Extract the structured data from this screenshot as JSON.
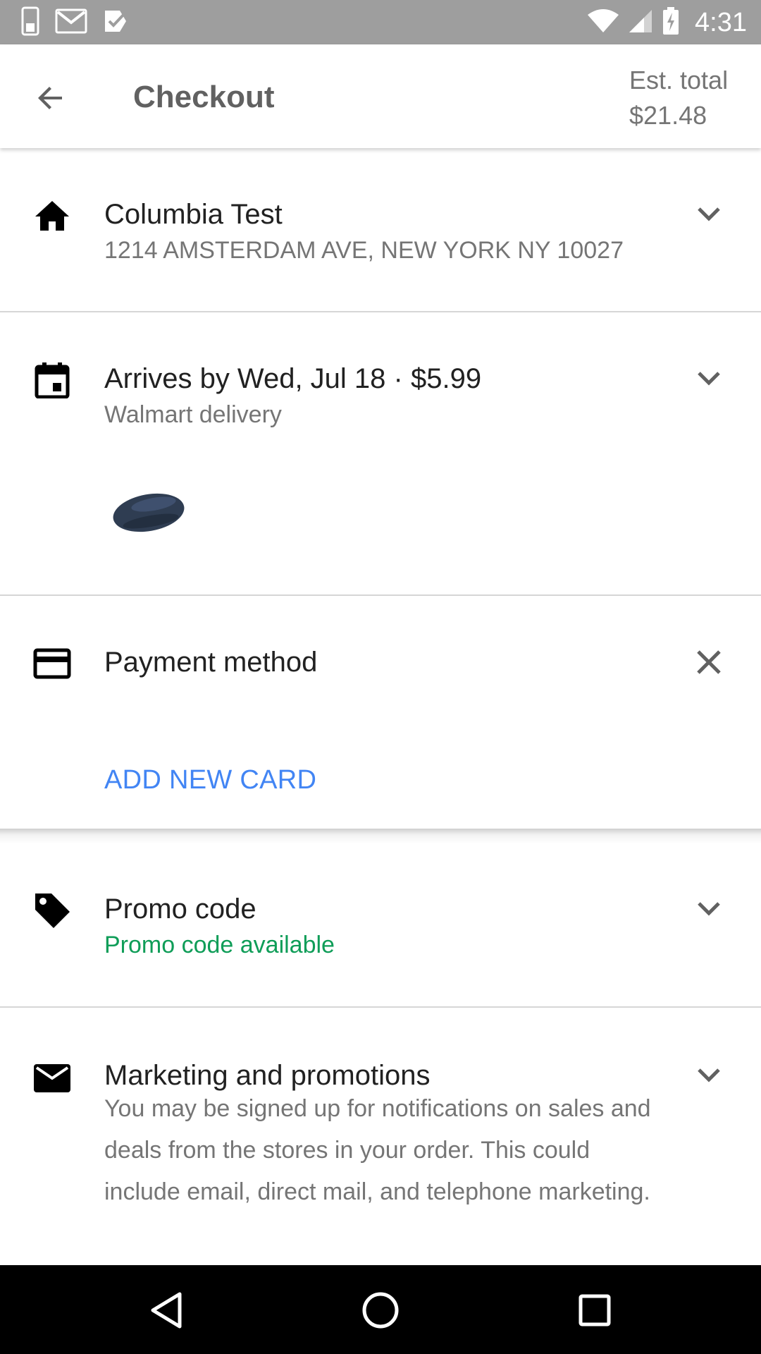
{
  "status_bar": {
    "time": "4:31",
    "left_icons": [
      "sim-card-icon",
      "gmail-icon",
      "task-check-icon"
    ],
    "right_icons": [
      "wifi-icon",
      "cell-signal-icon",
      "battery-charging-icon"
    ]
  },
  "app_bar": {
    "title": "Checkout",
    "est_total_label": "Est. total",
    "est_total_value": "$21.48"
  },
  "sections": {
    "address": {
      "icon": "home-icon",
      "name": "Columbia Test",
      "address": "1214 AMSTERDAM AVE, NEW YORK NY 10027"
    },
    "delivery": {
      "icon": "calendar-icon",
      "title": "Arrives by Wed, Jul 18 · $5.99",
      "subtitle": "Walmart delivery",
      "item_image": "computer-mouse-product-image"
    },
    "payment": {
      "icon": "credit-card-icon",
      "title": "Payment method",
      "action": "ADD NEW CARD"
    },
    "promo": {
      "icon": "tag-icon",
      "title": "Promo code",
      "subtitle": "Promo code available",
      "subtitle_color": "#0f9d58"
    },
    "marketing": {
      "icon": "mail-icon",
      "title": "Marketing and promotions",
      "body": "You may be signed up for notifications on sales and deals from the stores in your order. This could include email, direct mail, and telephone marketing."
    }
  },
  "colors": {
    "status_bar": "#9e9e9e",
    "accent_link": "#4285f4",
    "promo_green": "#0f9d58",
    "nav_bar": "#000000"
  }
}
